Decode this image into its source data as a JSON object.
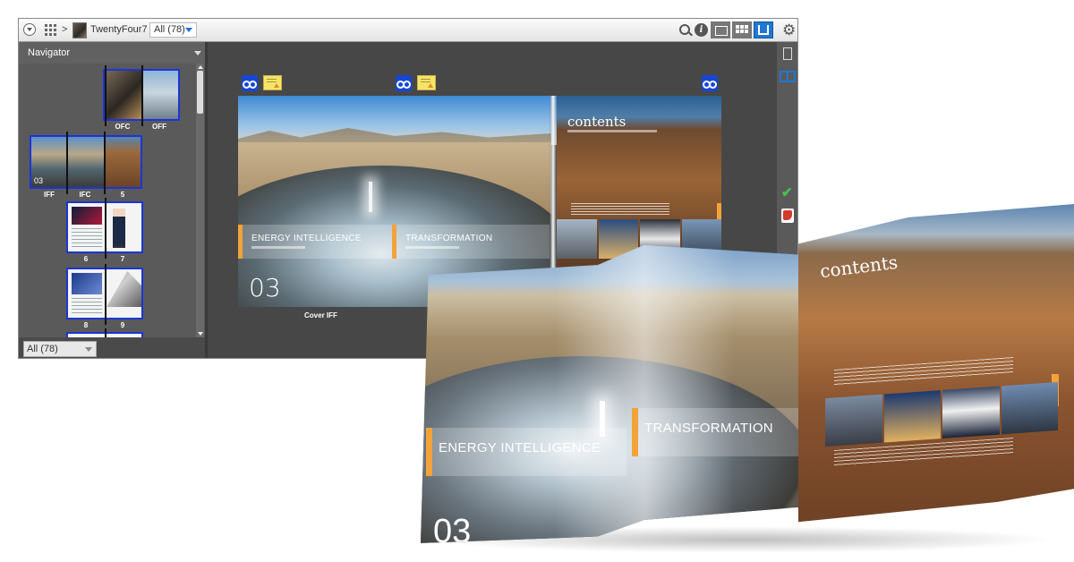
{
  "toolbar": {
    "separator_1": ">",
    "separator_2": ">",
    "publication_title": "TwentyFour7",
    "filter_value": "All (78)",
    "info_glyph": "i",
    "icons": [
      "dropdown-circle-icon",
      "app-grid-icon",
      "search-icon",
      "info-icon",
      "folder-view-icon",
      "grid-view-icon",
      "spread-view-icon",
      "gear-icon"
    ],
    "active_view": "spread-view",
    "accent_color": "#1f78d1"
  },
  "navigator": {
    "title": "Navigator",
    "spreads": [
      {
        "labels": [
          "OFC",
          "OFF"
        ]
      },
      {
        "labels": [
          "IFF",
          "IFC",
          "5"
        ],
        "overlay": "03"
      },
      {
        "labels": [
          "6",
          "7"
        ]
      },
      {
        "labels": [
          "8",
          "9"
        ]
      }
    ],
    "footer_filter": "All (78)"
  },
  "viewer": {
    "spread_label": "Cover IFF",
    "page_left_heading": "ENERGY INTELLIGENCE",
    "page_right_heading": "TRANSFORMATION",
    "page_number": "03",
    "contents_title": "contents",
    "approval_colors": {
      "approve": "#49c24a",
      "reject": "#d23a2a"
    }
  },
  "photo": {
    "left_heading": "ENERGY INTELLIGENCE",
    "right_heading": "TRANSFORMATION",
    "page_number": "03",
    "contents_title": "contents"
  }
}
